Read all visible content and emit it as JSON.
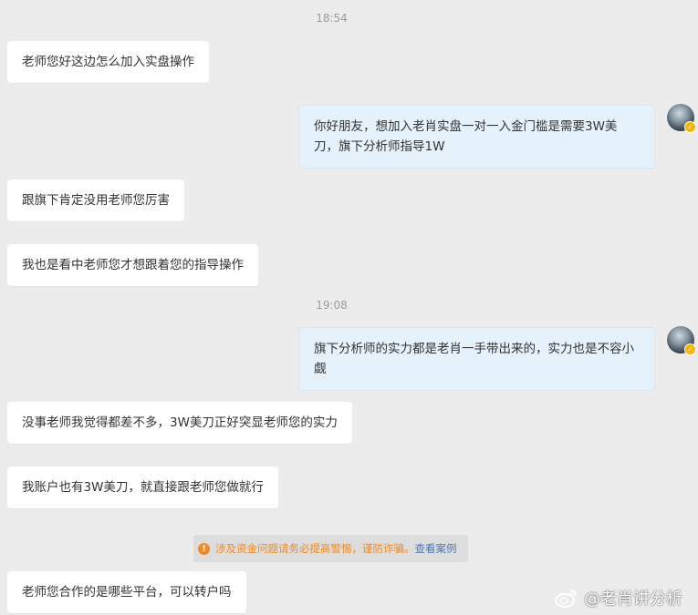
{
  "timestamps": [
    "18:54",
    "19:08"
  ],
  "messages": [
    {
      "side": "in",
      "text": "老师您好这边怎么加入实盘操作"
    },
    {
      "side": "out",
      "text": "你好朋友，想加入老肖实盘一对一入金门槛是需要3W美刀，旗下分析师指导1W"
    },
    {
      "side": "in",
      "text": "跟旗下肯定没用老师您厉害"
    },
    {
      "side": "in",
      "text": "我也是看中老师您才想跟着您的指导操作"
    },
    {
      "side": "out",
      "text": "旗下分析师的实力都是老肖一手带出来的，实力也是不容小觑"
    },
    {
      "side": "in",
      "text": "没事老师我觉得都差不多，3W美刀正好突显老师您的实力"
    },
    {
      "side": "in",
      "text": "我账户也有3W美刀，就直接跟老师您做就行"
    },
    {
      "side": "in",
      "text": "老师您合作的是哪些平台，可以转户吗"
    }
  ],
  "notice": {
    "icon": "info-icon",
    "warning_text": "涉及资金问题请务必提高警惕，谨防诈骗。",
    "link_text": "查看案例",
    "warning_color": "#f08a24",
    "link_color": "#4a79b8"
  },
  "watermark": {
    "icon": "weibo-icon",
    "text": "@老肖讲分析"
  },
  "colors": {
    "background": "#ececec",
    "incoming_bubble": "#ffffff",
    "outgoing_bubble": "#e5f1fb",
    "verified_badge": "#f4b400"
  }
}
